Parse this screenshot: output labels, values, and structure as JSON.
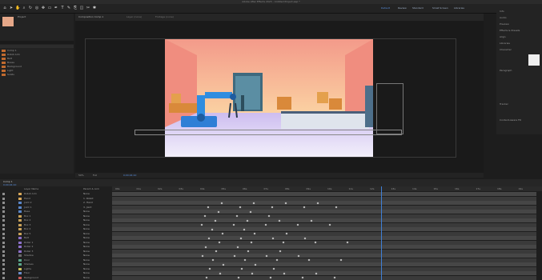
{
  "app": {
    "title": "Adobe After Effects 2023 - Untitled Project.aep *"
  },
  "toolbar": {
    "workspaces": [
      "Default",
      "Review",
      "Standard",
      "Small Screen",
      "Libraries"
    ],
    "search_placeholder": "Search Help"
  },
  "project": {
    "header": "Project",
    "items": [
      "Comp 1",
      "Robot Arm",
      "Belt",
      "Boxes",
      "Background",
      "Light",
      "Solids"
    ]
  },
  "composition": {
    "tabs": [
      "Composition Comp 1",
      "Layer (none)",
      "Footage (none)"
    ],
    "zoom": "50%",
    "resolution": "Full",
    "timecode": "0;00;04;10"
  },
  "right_panel": {
    "items": [
      "Info",
      "Audio",
      "Preview",
      "Effects & Presets",
      "Align",
      "Libraries",
      "Character",
      "Paragraph",
      "Tracker",
      "Content-Aware Fill"
    ]
  },
  "timeline": {
    "tab": "Comp 1",
    "timecode": "0;00;04;10",
    "columns": [
      "Layer Name",
      "Parent & Link"
    ],
    "layers": [
      {
        "name": "Robot Arm",
        "color": "#d7a75a",
        "parent": "None"
      },
      {
        "name": "Hand",
        "color": "#d7a75a",
        "parent": "1. Robot"
      },
      {
        "name": "Joint 2",
        "color": "#5a86c9",
        "parent": "2. Hand"
      },
      {
        "name": "Joint 1",
        "color": "#5a86c9",
        "parent": "3. Joint"
      },
      {
        "name": "Base",
        "color": "#5a86c9",
        "parent": "None"
      },
      {
        "name": "Box 1",
        "color": "#c9a25a",
        "parent": "None"
      },
      {
        "name": "Box 2",
        "color": "#c9a25a",
        "parent": "None"
      },
      {
        "name": "Box 3",
        "color": "#c9a25a",
        "parent": "None"
      },
      {
        "name": "Box 4",
        "color": "#c9a25a",
        "parent": "None"
      },
      {
        "name": "Box 5",
        "color": "#c9a25a",
        "parent": "None"
      },
      {
        "name": "Belt",
        "color": "#8c6fc9",
        "parent": "None"
      },
      {
        "name": "Roller 1",
        "color": "#8c6fc9",
        "parent": "None"
      },
      {
        "name": "Roller 2",
        "color": "#8c6fc9",
        "parent": "None"
      },
      {
        "name": "Roller 3",
        "color": "#8c6fc9",
        "parent": "None"
      },
      {
        "name": "Shadow",
        "color": "#6b6b6b",
        "parent": "None"
      },
      {
        "name": "Door",
        "color": "#5aa88c",
        "parent": "None"
      },
      {
        "name": "Shelves",
        "color": "#5aa88c",
        "parent": "None"
      },
      {
        "name": "Lights",
        "color": "#c9c05a",
        "parent": "None"
      },
      {
        "name": "Floor",
        "color": "#6b8cc9",
        "parent": "None"
      },
      {
        "name": "Background",
        "color": "#c95a5a",
        "parent": "None"
      }
    ],
    "ruler_labels": [
      "00s",
      "01s",
      "02s",
      "03s",
      "04s",
      "05s",
      "06s",
      "07s",
      "08s",
      "09s",
      "10s",
      "11s",
      "12s",
      "13s",
      "14s",
      "15s",
      "16s",
      "17s",
      "18s",
      "19s"
    ]
  }
}
